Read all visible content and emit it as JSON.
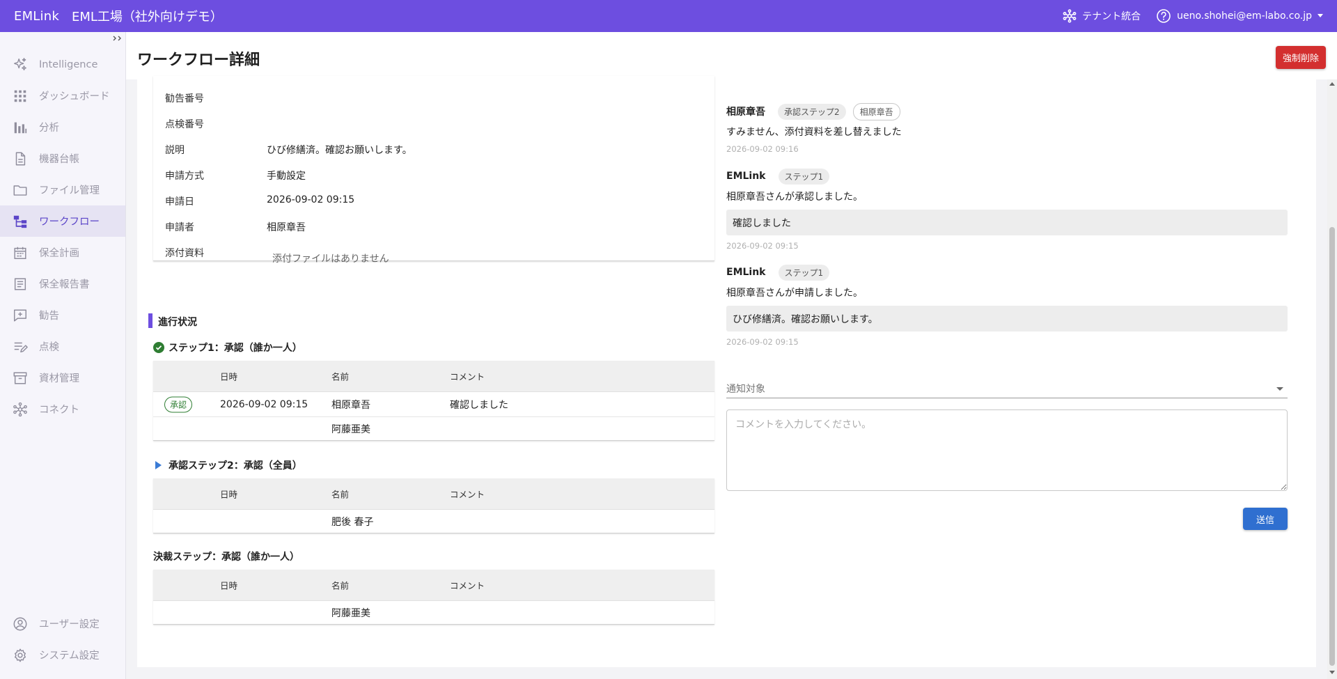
{
  "topbar": {
    "brand": "EMLink",
    "org": "EML工場（社外向けデモ）",
    "tenant_label": "テナント統合",
    "user_label": "ueno.shohei@em-labo.co.jp"
  },
  "sidebar": {
    "collapse_label": "››‹",
    "items": [
      {
        "label": "Intelligence",
        "icon": "sparkle-icon"
      },
      {
        "label": "ダッシュボード",
        "icon": "grid-icon"
      },
      {
        "label": "分析",
        "icon": "bar-chart-icon"
      },
      {
        "label": "機器台帳",
        "icon": "document-icon"
      },
      {
        "label": "ファイル管理",
        "icon": "folder-icon"
      },
      {
        "label": "ワークフロー",
        "icon": "workflow-icon",
        "active": true
      },
      {
        "label": "保全計画",
        "icon": "calendar-icon"
      },
      {
        "label": "保全報告書",
        "icon": "report-icon"
      },
      {
        "label": "勧告",
        "icon": "add-comment-icon"
      },
      {
        "label": "点検",
        "icon": "checklist-icon"
      },
      {
        "label": "資材管理",
        "icon": "archive-icon"
      },
      {
        "label": "コネクト",
        "icon": "hub-icon"
      }
    ],
    "bottom_items": [
      {
        "label": "ユーザー設定",
        "icon": "user-circle-icon"
      },
      {
        "label": "システム設定",
        "icon": "gear-icon"
      }
    ]
  },
  "page": {
    "title": "ワークフロー詳細",
    "force_delete_label": "強制削除"
  },
  "info": {
    "rows": [
      {
        "label": "勧告番号",
        "value": ""
      },
      {
        "label": "点検番号",
        "value": ""
      },
      {
        "label": "説明",
        "value": "ひび修繕済。確認お願いします。"
      },
      {
        "label": "申請方式",
        "value": "手動設定"
      },
      {
        "label": "申請日",
        "value": "2026-09-02 09:15"
      },
      {
        "label": "申請者",
        "value": "相原章吾"
      },
      {
        "label": "添付資料",
        "value": "添付ファイルはありません"
      }
    ]
  },
  "progress": {
    "title": "進行状況",
    "columns": {
      "date": "日時",
      "name": "名前",
      "comment": "コメント"
    },
    "steps": [
      {
        "title": "ステップ1：承認（誰か一人）",
        "rows": [
          {
            "status": "承認",
            "date": "2026-09-02 09:15",
            "name": "相原章吾",
            "comment": "確認しました"
          },
          {
            "status": "",
            "date": "",
            "name": "阿藤亜美",
            "comment": ""
          }
        ]
      },
      {
        "title": "承認ステップ2：承認（全員）",
        "rows": [
          {
            "status": "",
            "date": "",
            "name": "肥後 春子",
            "comment": ""
          }
        ]
      },
      {
        "title": "決裁ステップ：承認（誰か一人）",
        "rows": [
          {
            "status": "",
            "date": "",
            "name": "阿藤亜美",
            "comment": ""
          }
        ]
      }
    ]
  },
  "comments": [
    {
      "author": "相原章吾",
      "tags": [
        "承認ステップ2",
        "相原章吾"
      ],
      "text": "すみません、添付資料を差し替えました",
      "box": "",
      "time": "2026-09-02 09:16"
    },
    {
      "author": "EMLink",
      "tags": [
        "ステップ1"
      ],
      "text": "相原章吾さんが承認しました。",
      "box": "確認しました",
      "time": "2026-09-02 09:15"
    },
    {
      "author": "EMLink",
      "tags": [
        "ステップ1"
      ],
      "text": "相原章吾さんが申請しました。",
      "box": "ひび修繕済。確認お願いします。",
      "time": "2026-09-02 09:15"
    }
  ],
  "form": {
    "notify_placeholder": "通知対象",
    "comment_placeholder": "コメントを入力してください。",
    "send_label": "送信"
  },
  "colors": {
    "accent": "#6d4ee0",
    "danger": "#d32f2f",
    "primary_button": "#2f6fd0",
    "success": "#2e7d32"
  }
}
